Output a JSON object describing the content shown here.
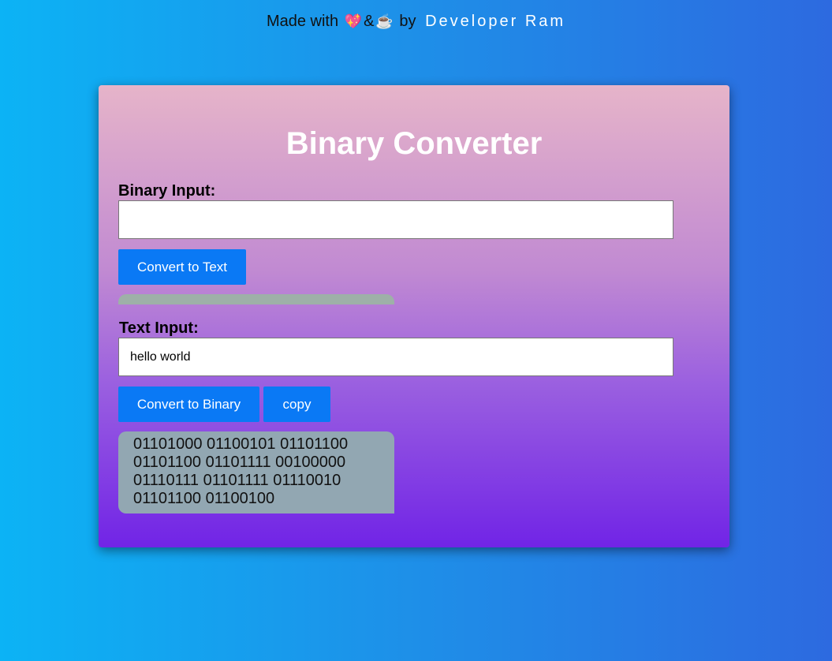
{
  "credit": {
    "prefix": "Made with",
    "heart_emoji": "💖",
    "ampersand": "&",
    "coffee_emoji": "☕",
    "by": "by",
    "author": "Developer Ram"
  },
  "converter": {
    "title": "Binary Converter",
    "binary_label": "Binary Input:",
    "binary_value": "",
    "to_text_button": "Convert to Text",
    "text_output": "",
    "text_label": "Text Input:",
    "text_value": "hello world",
    "to_binary_button": "Convert to Binary",
    "copy_button": "copy",
    "binary_output": "01101000 01100101 01101100 01101100 01101111 00100000 01110111 01101111 01110010 01101100 01100100"
  },
  "colors": {
    "button": "#0a79f5",
    "output_bg": "#92a7b2"
  }
}
